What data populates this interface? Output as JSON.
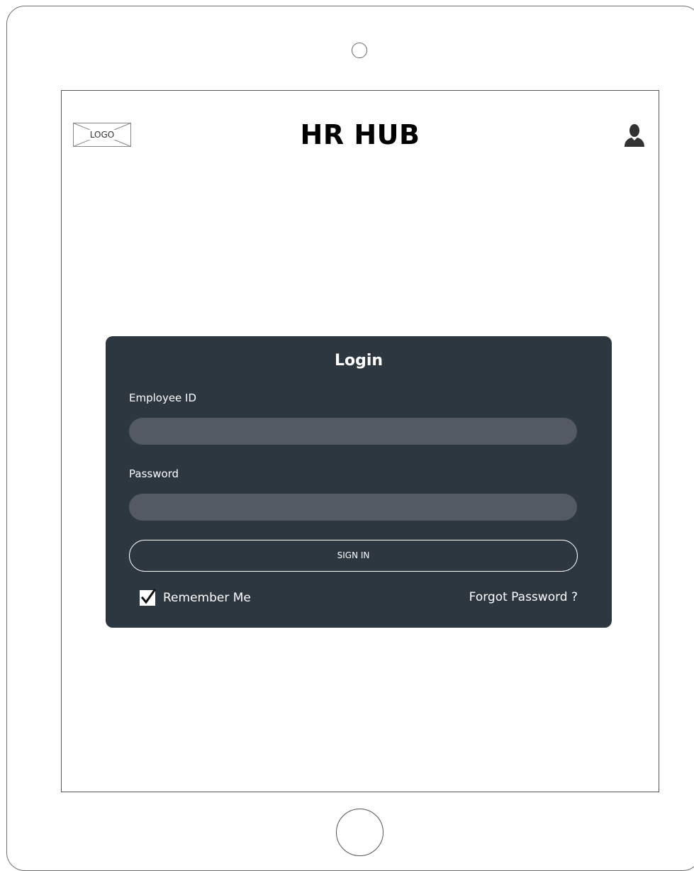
{
  "header": {
    "logo_text": "LOGO",
    "title": "HR HUB",
    "user_icon": "user-icon"
  },
  "login": {
    "title": "Login",
    "employee_id_label": "Employee ID",
    "employee_id_value": "",
    "password_label": "Password",
    "password_value": "",
    "sign_in_label": "SIGN IN",
    "remember_me_label": "Remember Me",
    "remember_me_checked": true,
    "forgot_password_label": "Forgot Password ?"
  },
  "colors": {
    "card_background": "#2d3740",
    "input_background": "#535a63",
    "text_on_card": "#ffffff"
  }
}
